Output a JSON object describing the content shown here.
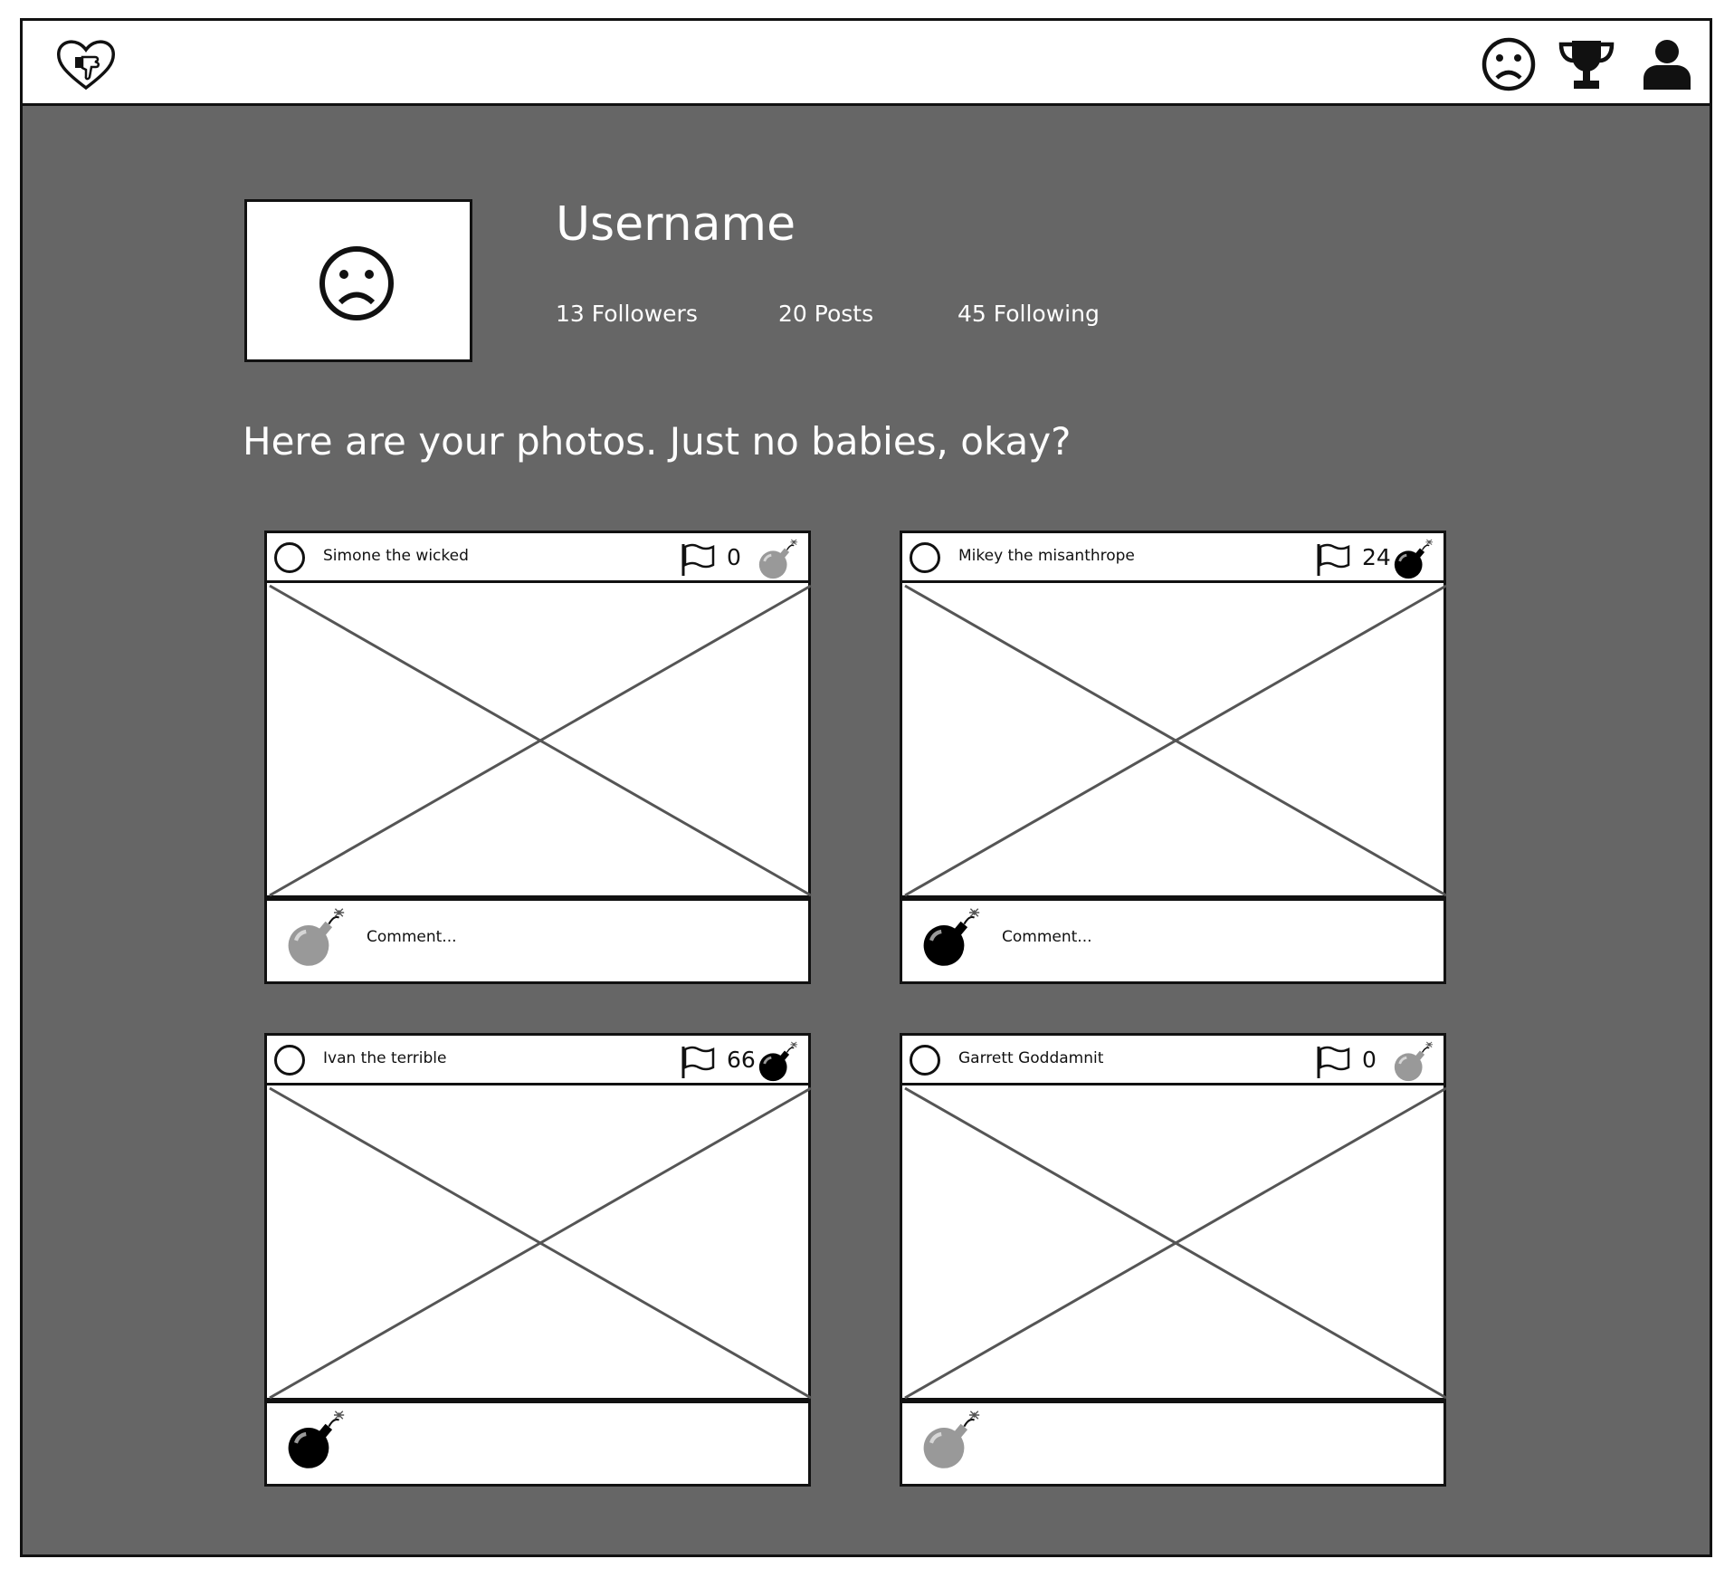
{
  "nav": {
    "logo_icon": "heart-thumbs-down-icon",
    "icons": [
      "sad-face-icon",
      "trophy-icon",
      "user-icon"
    ]
  },
  "profile": {
    "username": "Username",
    "avatar_icon": "sad-face-icon",
    "stats": {
      "followers": "13 Followers",
      "posts": "20 Posts",
      "following": "45 Following"
    }
  },
  "intro": "Here are your photos. Just no babies, okay?",
  "posts": [
    {
      "author": "Simone the wicked",
      "bombs": "0",
      "bombed": false,
      "comment_placeholder": "Comment..."
    },
    {
      "author": "Mikey the misanthrope",
      "bombs": "24",
      "bombed": true,
      "comment_placeholder": "Comment..."
    },
    {
      "author": "Ivan the terrible",
      "bombs": "66",
      "bombed": true,
      "comment_placeholder": ""
    },
    {
      "author": "Garrett Goddamnit",
      "bombs": "0",
      "bombed": false,
      "comment_placeholder": ""
    }
  ],
  "colors": {
    "background": "#666666",
    "bomb_active": "#000000",
    "bomb_inactive": "#999999"
  }
}
